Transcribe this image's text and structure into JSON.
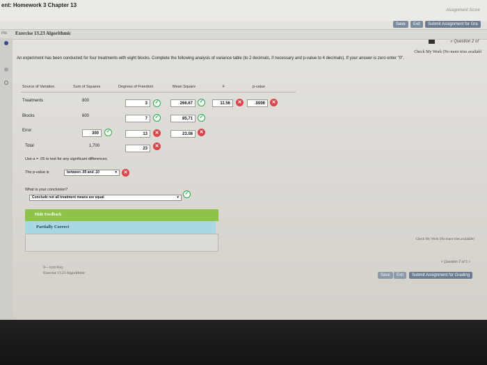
{
  "header": {
    "title": "ent: Homework 3 Chapter 13",
    "assignment_score": "Assignment Score",
    "save": "Save",
    "exit": "Exit",
    "submit": "Submit Assignment for Gra",
    "question_nav": "« Question 2 of"
  },
  "exercise": {
    "side_label": "ms",
    "title": "Exercise 13.23 Algorithmic",
    "check_my_work": "Check My Work (No more tries availabl"
  },
  "question": {
    "text": "An experiment has been conducted for four treatments with eight blocks. Complete the following analysis of variance table (to 2 decimals, if necessary and p-value to 4 decimals). If your answer is zero enter \"0\"."
  },
  "table": {
    "headers": [
      "Source of Variation",
      "Sum of Squares",
      "Degrees of Freedom",
      "Mean Square",
      "F",
      "p-value"
    ],
    "rows": [
      {
        "label": "Treatments",
        "ss": "800",
        "df": "3",
        "ms": "266.67",
        "f": "11.56",
        "p": ".0006"
      },
      {
        "label": "Blocks",
        "ss": "600",
        "df": "7",
        "ms": "85.71"
      },
      {
        "label": "Error",
        "ss": "300",
        "df": "13",
        "ms": "23.08"
      },
      {
        "label": "Total",
        "ss": "1,700",
        "df": "23"
      }
    ]
  },
  "use_alpha": "Use α = .05 to test for any significant differences.",
  "pvalue": {
    "label": "The p-value is",
    "selected": "between .05 and .10"
  },
  "conclusion": {
    "question": "What is your conclusion?",
    "selected": "Conclude not all treatment means are equal"
  },
  "feedback": {
    "hide": "Hide Feedback",
    "status": "Partially Correct"
  },
  "footer": {
    "check_my_work": "Check My Work (No more tries available)",
    "question_nav": "« Question 2 of 5 »",
    "exam_key": "0— Icon Key",
    "exercise": "Exercise 13.23 Algorithmic",
    "save": "Save",
    "exit": "Exit",
    "submit": "Submit Assignment for Grading"
  },
  "colors": {
    "correct": "#27a84a",
    "incorrect": "#d9454a",
    "feedback_green": "#8ec248",
    "feedback_blue": "#a9d7e2"
  }
}
